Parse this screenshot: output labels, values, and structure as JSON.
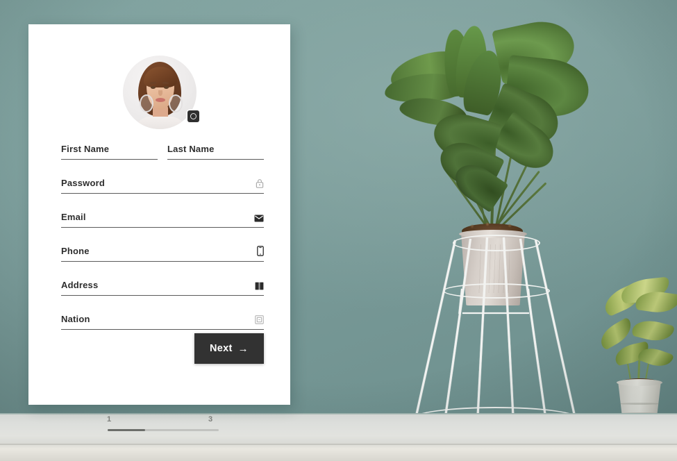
{
  "scene": {
    "wall_color": "#7d9e9c",
    "shelf_color": "#dcdedb",
    "card_color": "#ffffff"
  },
  "card": {
    "avatar": {
      "name": "user-avatar",
      "alt": "Profile photo of a woman",
      "badge_icon": "camera-icon"
    },
    "fields": [
      {
        "id": "first-name",
        "label": "First Name",
        "value": "",
        "placeholder": "First Name",
        "icon": ""
      },
      {
        "id": "last-name",
        "label": "Last Name",
        "value": "",
        "placeholder": "Last Name",
        "icon": ""
      },
      {
        "id": "password",
        "label": "Password",
        "value": "",
        "placeholder": "Password",
        "icon": "lock-icon"
      },
      {
        "id": "email",
        "label": "Email",
        "value": "",
        "placeholder": "Email",
        "icon": "envelope-icon"
      },
      {
        "id": "phone",
        "label": "Phone",
        "value": "",
        "placeholder": "Phone",
        "icon": "mobile-phone-icon"
      },
      {
        "id": "address",
        "label": "Address",
        "value": "",
        "placeholder": "Address",
        "icon": "open-book-icon"
      },
      {
        "id": "nation",
        "label": "Nation",
        "value": "",
        "placeholder": "Nation",
        "icon": "id-card-icon"
      }
    ],
    "next_button": {
      "label": "Next",
      "arrow": "→",
      "background": "#323232",
      "text_color": "#ffffff"
    }
  },
  "steps": {
    "first_label": "1",
    "last_label": "3",
    "current": 1,
    "total": 3,
    "fill_percent": 34
  },
  "decor": {
    "big_plant": "fan-palm-plant",
    "plant_stand": "white-wire-plant-stand",
    "small_plant": "dieffenbachia-plant"
  }
}
